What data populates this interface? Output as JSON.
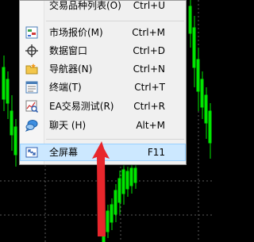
{
  "menu": {
    "top_item": {
      "label": "交易品种列表(O)",
      "shortcut": "Ctrl+U"
    },
    "items": [
      {
        "label": "市场报价(M)",
        "shortcut": "Ctrl+M",
        "icon": "market-watch-icon"
      },
      {
        "label": "数据窗口",
        "shortcut": "Ctrl+D",
        "icon": "crosshair-icon"
      },
      {
        "label": "导航器(N)",
        "shortcut": "Ctrl+N",
        "icon": "navigator-folder-icon"
      },
      {
        "label": "终端(T)",
        "shortcut": "Ctrl+T",
        "icon": "terminal-icon"
      },
      {
        "label": "EA交易测试(R)",
        "shortcut": "Ctrl+R",
        "icon": "strategy-tester-icon"
      },
      {
        "label": "聊天 (H)",
        "shortcut": "Alt+M",
        "icon": "chat-bubble-icon"
      }
    ],
    "fullscreen": {
      "label": "全屏幕",
      "shortcut": "F11",
      "icon": "fullscreen-icon"
    }
  },
  "colors": {
    "menu_bg": "#f0f0f0",
    "highlight_bg": "#cce8ff",
    "highlight_border": "#99d1ff",
    "chart_bg": "#000000",
    "candle_green": "#00e600",
    "grid_gray": "#5a5a5a",
    "arrow_red": "#e8262c"
  }
}
